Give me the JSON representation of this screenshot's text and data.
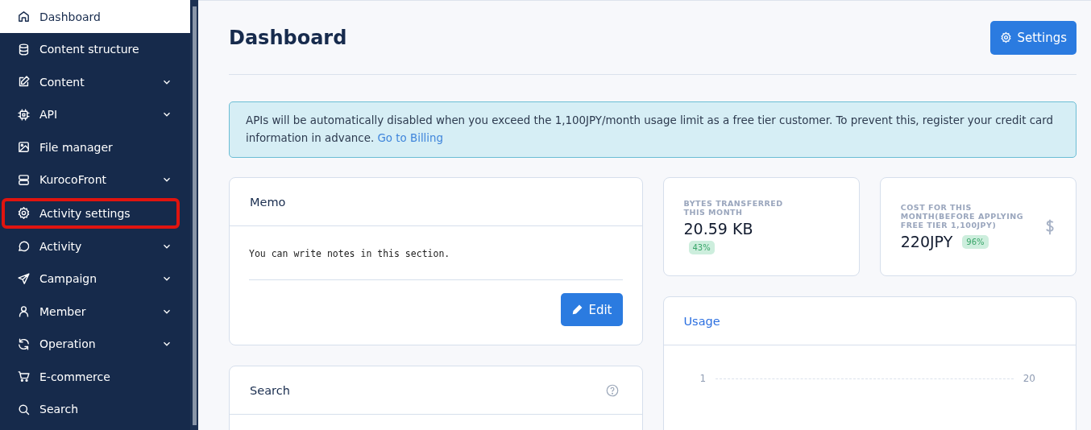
{
  "sidebar": {
    "items": [
      {
        "label": "Dashboard",
        "selected": true,
        "expandable": false,
        "highlighted": false
      },
      {
        "label": "Content structure",
        "selected": false,
        "expandable": false,
        "highlighted": false
      },
      {
        "label": "Content",
        "selected": false,
        "expandable": true,
        "highlighted": false
      },
      {
        "label": "API",
        "selected": false,
        "expandable": true,
        "highlighted": false
      },
      {
        "label": "File manager",
        "selected": false,
        "expandable": false,
        "highlighted": false
      },
      {
        "label": "KurocoFront",
        "selected": false,
        "expandable": true,
        "highlighted": false
      },
      {
        "label": "Activity settings",
        "selected": false,
        "expandable": false,
        "highlighted": true
      },
      {
        "label": "Activity",
        "selected": false,
        "expandable": true,
        "highlighted": false
      },
      {
        "label": "Campaign",
        "selected": false,
        "expandable": true,
        "highlighted": false
      },
      {
        "label": "Member",
        "selected": false,
        "expandable": true,
        "highlighted": false
      },
      {
        "label": "Operation",
        "selected": false,
        "expandable": true,
        "highlighted": false
      },
      {
        "label": "E-commerce",
        "selected": false,
        "expandable": false,
        "highlighted": false
      },
      {
        "label": "Search",
        "selected": false,
        "expandable": false,
        "highlighted": false
      }
    ]
  },
  "header": {
    "title": "Dashboard",
    "button": "Settings"
  },
  "alert": {
    "text": "APIs will be automatically disabled when you exceed the 1,100JPY/month usage limit as a free tier customer. To prevent this, register your credit card information in advance.",
    "link": "Go to Billing"
  },
  "memo": {
    "title": "Memo",
    "text": "You can write notes in this section.",
    "button": "Edit"
  },
  "search_card": {
    "title": "Search"
  },
  "stats": [
    {
      "label": "BYTES TRANSFERRED THIS MONTH",
      "value": "20.59 KB",
      "badge": "43%",
      "kind": "plain"
    },
    {
      "label": "COST FOR THIS MONTH(BEFORE APPLYING FREE TIER 1,100JPY)",
      "value": "220JPY",
      "badge": "96%",
      "kind": "dollar"
    }
  ],
  "usage": {
    "title": "Usage",
    "start_label": "1",
    "end_label": "20"
  }
}
